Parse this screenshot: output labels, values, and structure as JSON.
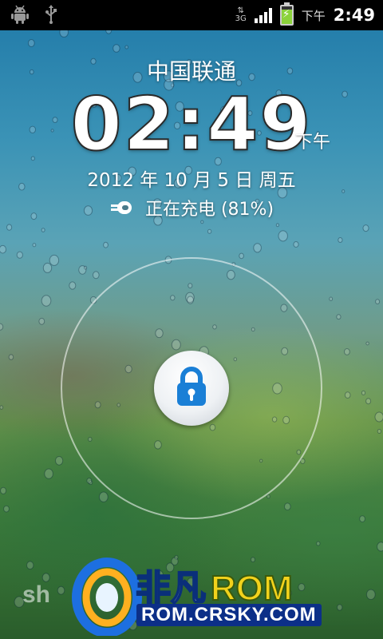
{
  "status_bar": {
    "ampm": "下午",
    "time": "2:49",
    "network_type": "3G",
    "battery_level": 0.81,
    "icons": [
      "android-debug-icon",
      "usb-icon",
      "data-3g-icon",
      "signal-icon",
      "battery-charging-icon"
    ]
  },
  "lockscreen": {
    "carrier": "中国联通",
    "clock": "02:49",
    "clock_ampm": "下午",
    "date": "2012 年 10 月 5 日 周五",
    "charging_status": "正在充电 (81%)",
    "unlock_icon": "lock-icon"
  },
  "watermark": {
    "left_text": "sh",
    "brand_cn": "非凡",
    "brand_en": "ROM",
    "url": "ROM.CRSKY.COM"
  },
  "colors": {
    "status_bar_bg": "#000000",
    "lock_blue": "#1a7fd6",
    "battery_green": "#8bd23b",
    "watermark_yellow": "#f2d21c",
    "watermark_blue": "#0c2f88"
  }
}
